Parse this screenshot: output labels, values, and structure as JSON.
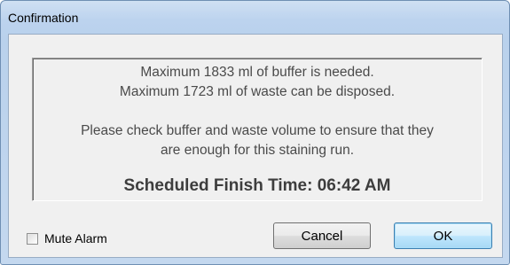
{
  "window": {
    "title": "Confirmation"
  },
  "message": {
    "line1": "Maximum 1833 ml of buffer is needed.",
    "line2": "Maximum 1723 ml of waste can be disposed.",
    "line3": "Please check buffer and waste volume to ensure that they",
    "line4": "are enough for this staining run.",
    "finish_time": "Scheduled Finish Time: 06:42 AM"
  },
  "controls": {
    "mute_alarm_label": "Mute Alarm",
    "mute_alarm_checked": false,
    "cancel_label": "Cancel",
    "ok_label": "OK"
  }
}
